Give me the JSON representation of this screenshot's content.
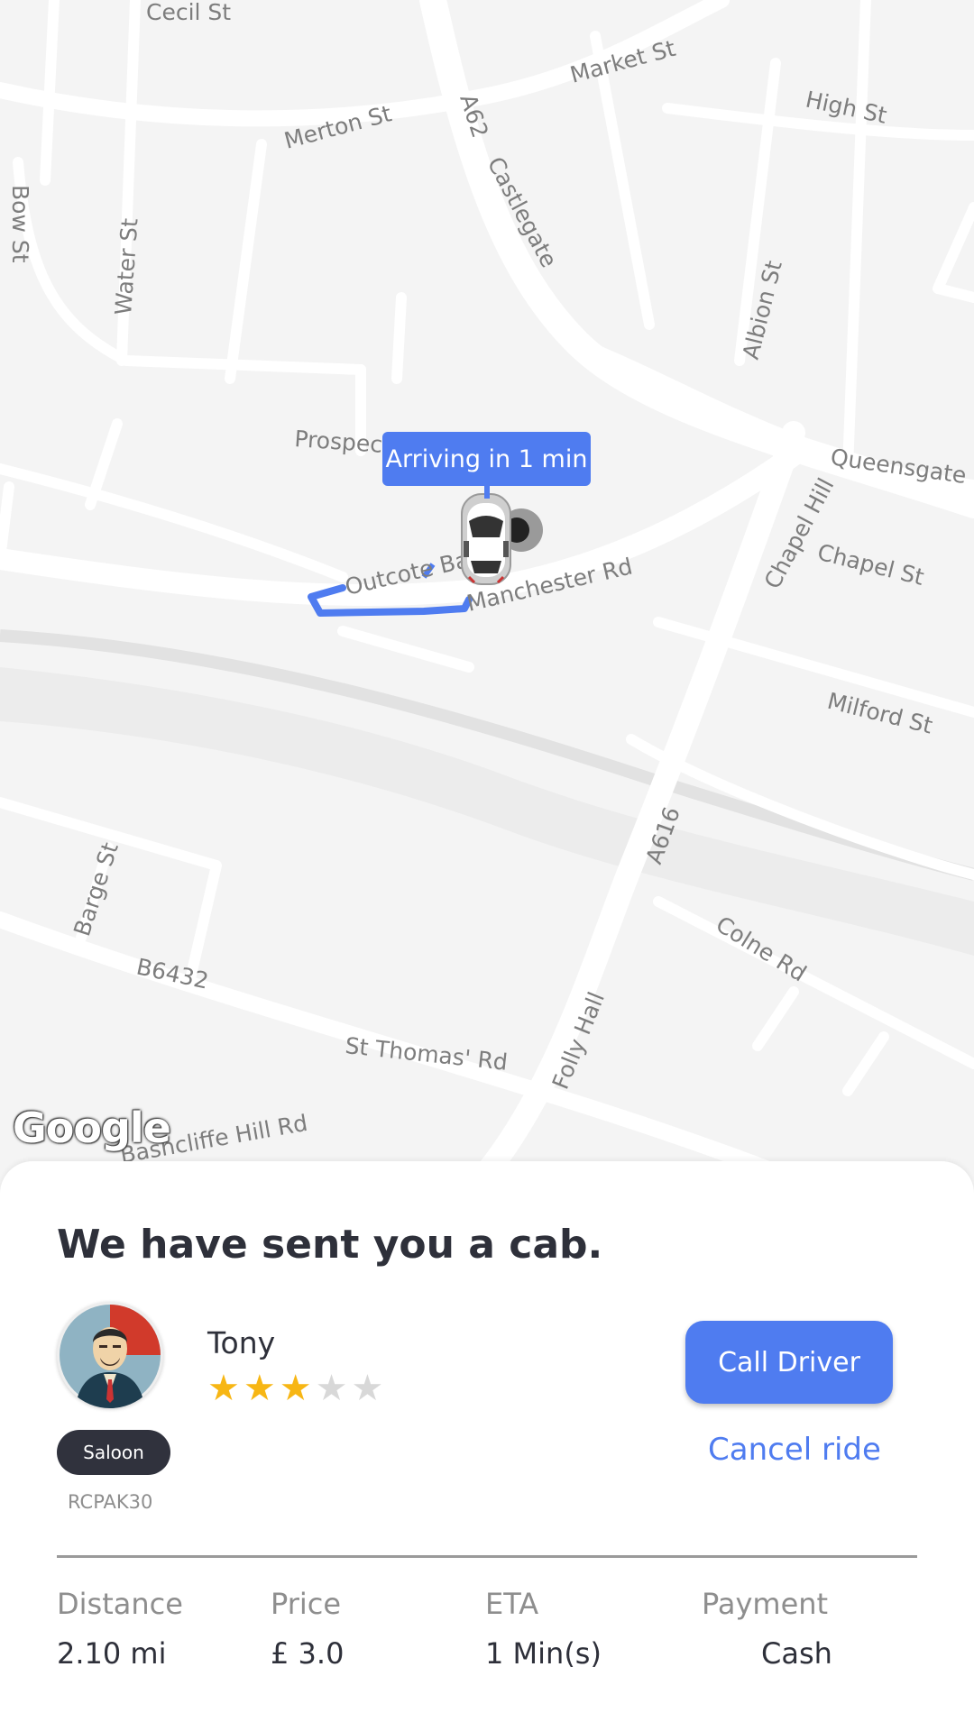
{
  "map": {
    "eta_bubble": "Arriving in 1 min",
    "logo": "Google",
    "streets": [
      "Cecil St",
      "Market St",
      "Merton St",
      "A62",
      "High St",
      "Bow St",
      "Water St",
      "Castlegate",
      "Albion St",
      "Prospect",
      "Queensgate",
      "Outcote Bar",
      "Manchester Rd",
      "Chapel Hill",
      "Chapel St",
      "Milford St",
      "A616",
      "Barge St",
      "Colne Rd",
      "B6432",
      "St Thomas' Rd",
      "Folly Hall",
      "Bashcliffe Hill Rd"
    ],
    "route_color": "#4f7cf0"
  },
  "sheet": {
    "title": "We have sent you a cab.",
    "driver": {
      "name": "Tony",
      "rating": 3,
      "rating_max": 5,
      "vehicle_type": "Saloon",
      "plate": "RCPAK30"
    },
    "call_button": "Call Driver",
    "cancel_link": "Cancel ride",
    "stats": [
      {
        "label": "Distance",
        "value": "2.10 mi"
      },
      {
        "label": "Price",
        "value": "£ 3.0"
      },
      {
        "label": "ETA",
        "value": "1 Min(s)"
      },
      {
        "label": "Payment",
        "value": "Cash"
      }
    ]
  },
  "colors": {
    "accent": "#4f7cf0",
    "badge": "#30323d",
    "star_on": "#f7b614",
    "star_off": "#d8d8d8"
  }
}
